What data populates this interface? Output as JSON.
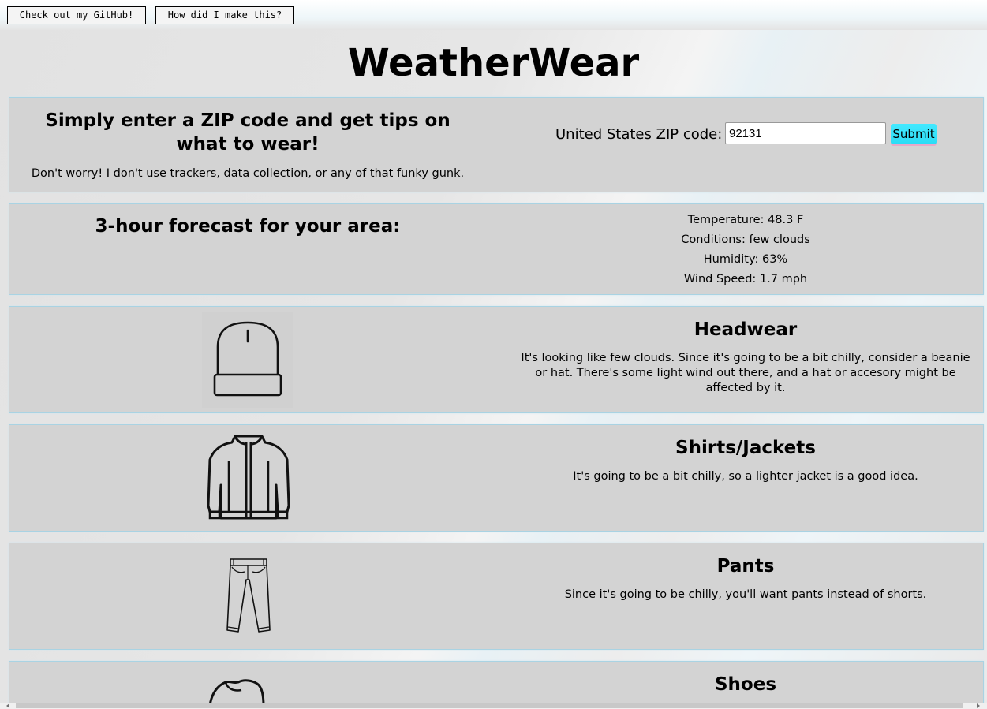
{
  "topbar": {
    "github_label": "Check out my GitHub!",
    "how_label": "How did I make this?"
  },
  "app": {
    "title": "WeatherWear"
  },
  "intro": {
    "heading": "Simply enter a ZIP code and get tips on what to wear!",
    "subtext": "Don't worry! I don't use trackers, data collection, or any of that funky gunk.",
    "zip_label": "United States ZIP code:",
    "zip_value": "92131",
    "submit_label": "Submit"
  },
  "forecast": {
    "heading": "3-hour forecast for your area:",
    "temperature": "Temperature: 48.3 F",
    "conditions": "Conditions: few clouds",
    "humidity": "Humidity: 63%",
    "wind": "Wind Speed: 1.7 mph"
  },
  "clothing": {
    "headwear": {
      "title": "Headwear",
      "text": "It's looking like few clouds. Since it's going to be a bit chilly, consider a beanie or hat. There's some light wind out there, and a hat or accesory might be affected by it.",
      "icon": "beanie-icon"
    },
    "shirts": {
      "title": "Shirts/Jackets",
      "text": "It's going to be a bit chilly, so a lighter jacket is a good idea.",
      "icon": "jacket-icon"
    },
    "pants": {
      "title": "Pants",
      "text": "Since it's going to be chilly, you'll want pants instead of shorts.",
      "icon": "jeans-icon"
    },
    "shoes": {
      "title": "Shoes",
      "icon": "shoe-icon"
    }
  }
}
